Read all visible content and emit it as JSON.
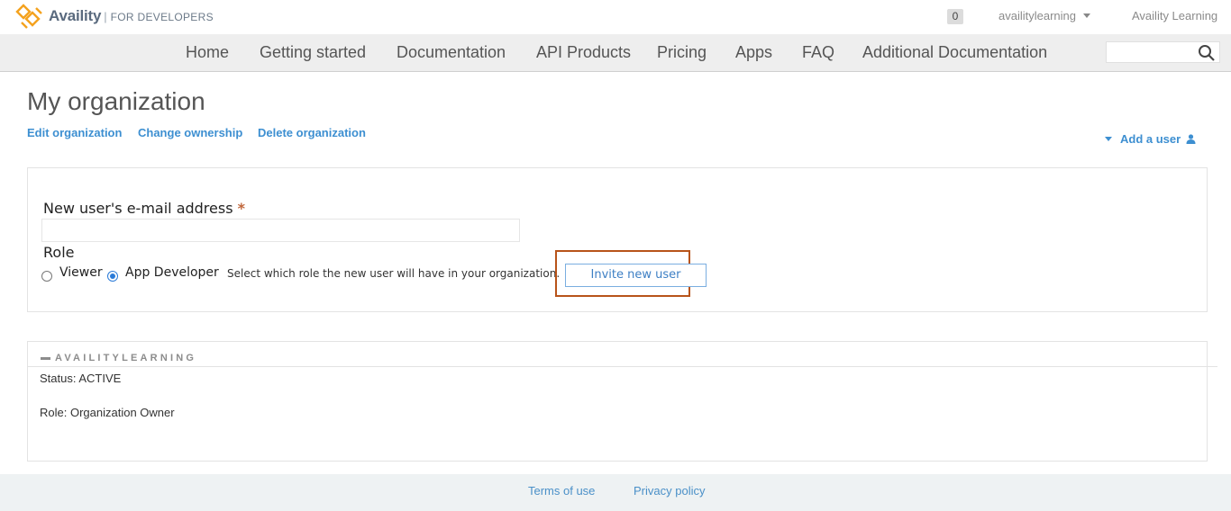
{
  "header": {
    "logo_word": "Availity",
    "logo_suffix": "FOR DEVELOPERS",
    "cart_count": "0",
    "username": "availitylearning",
    "brand_link": "Availity Learning",
    "colors": {
      "logo_orange": "#f4a21e",
      "logo_text": "#5a6a7e"
    }
  },
  "nav": {
    "items": [
      "Home",
      "Getting started",
      "Documentation",
      "API Products",
      "Pricing",
      "Apps",
      "FAQ",
      "Additional Documentation"
    ],
    "search_icon": "search-icon"
  },
  "page": {
    "title": "My organization",
    "actions": [
      "Edit organization",
      "Change ownership",
      "Delete organization"
    ],
    "add_user": "Add a user"
  },
  "invite_form": {
    "email_label": "New user's e-mail address",
    "required_mark": "*",
    "email_value": "",
    "role_label": "Role",
    "roles": [
      {
        "label": "Viewer",
        "selected": false
      },
      {
        "label": "App Developer",
        "selected": true
      }
    ],
    "role_help": "Select which role the new user will have in your organization.",
    "invite_button": "Invite new user",
    "highlight_color": "#b8541a"
  },
  "member": {
    "name": "AVAILITYLEARNING",
    "status": "Status: ACTIVE",
    "role": "Role: Organization Owner"
  },
  "footer": {
    "links": [
      "Terms of use",
      "Privacy policy"
    ]
  }
}
